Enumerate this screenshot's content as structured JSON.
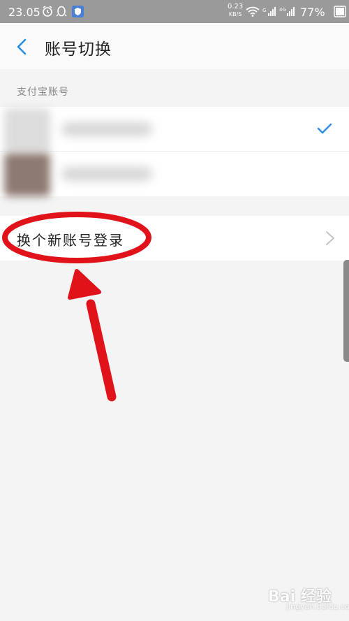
{
  "status_bar": {
    "time": "23.05",
    "net_speed_value": "0.23",
    "net_speed_unit": "KB/S",
    "battery": "77%"
  },
  "nav": {
    "title": "账号切换"
  },
  "section": {
    "label": "支付宝账号"
  },
  "accounts": [
    {
      "selected": true
    },
    {
      "selected": false
    }
  ],
  "actions": {
    "login_new": "换个新账号登录"
  },
  "watermark": {
    "text": "Bai 经验",
    "sub": "jingyan.baidu.com"
  },
  "colors": {
    "accent": "#2a8de0",
    "annotation": "#e0121a"
  }
}
